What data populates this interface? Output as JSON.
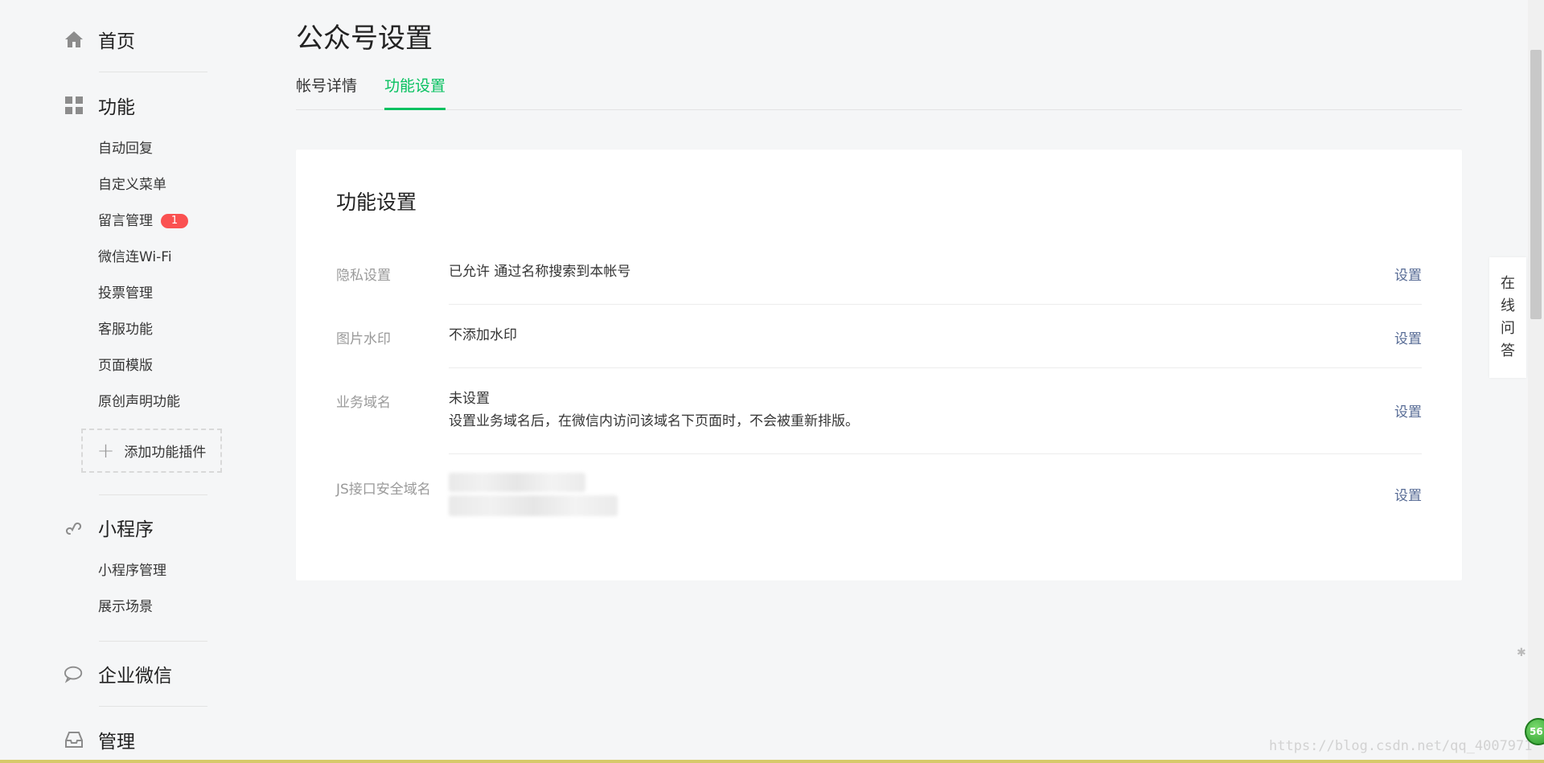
{
  "sidebar": {
    "home": {
      "label": "首页"
    },
    "features": {
      "label": "功能",
      "items": [
        {
          "label": "自动回复"
        },
        {
          "label": "自定义菜单"
        },
        {
          "label": "留言管理",
          "badge": "1"
        },
        {
          "label": "微信连Wi-Fi"
        },
        {
          "label": "投票管理"
        },
        {
          "label": "客服功能"
        },
        {
          "label": "页面模版"
        },
        {
          "label": "原创声明功能"
        }
      ],
      "add_plugin": "添加功能插件"
    },
    "miniprogram": {
      "label": "小程序",
      "items": [
        {
          "label": "小程序管理"
        },
        {
          "label": "展示场景"
        }
      ]
    },
    "enterprise": {
      "label": "企业微信"
    },
    "manage": {
      "label": "管理"
    }
  },
  "main": {
    "title": "公众号设置",
    "tabs": [
      {
        "label": "帐号详情"
      },
      {
        "label": "功能设置"
      }
    ],
    "card": {
      "title": "功能设置",
      "rows": [
        {
          "label": "隐私设置",
          "value": "已允许 通过名称搜索到本帐号",
          "action": "设置"
        },
        {
          "label": "图片水印",
          "value": "不添加水印",
          "action": "设置"
        },
        {
          "label": "业务域名",
          "value": "未设置",
          "note": "设置业务域名后，在微信内访问该域名下页面时，不会被重新排版。",
          "action": "设置"
        },
        {
          "label": "JS接口安全域名",
          "action": "设置"
        }
      ]
    }
  },
  "float_qa": [
    "在",
    "线",
    "问",
    "答"
  ],
  "watermark": "https://blog.csdn.net/qq_4007971",
  "corner_badge": "56",
  "colors": {
    "accent": "#07c160",
    "link": "#576b95",
    "badge": "#fa5151"
  }
}
